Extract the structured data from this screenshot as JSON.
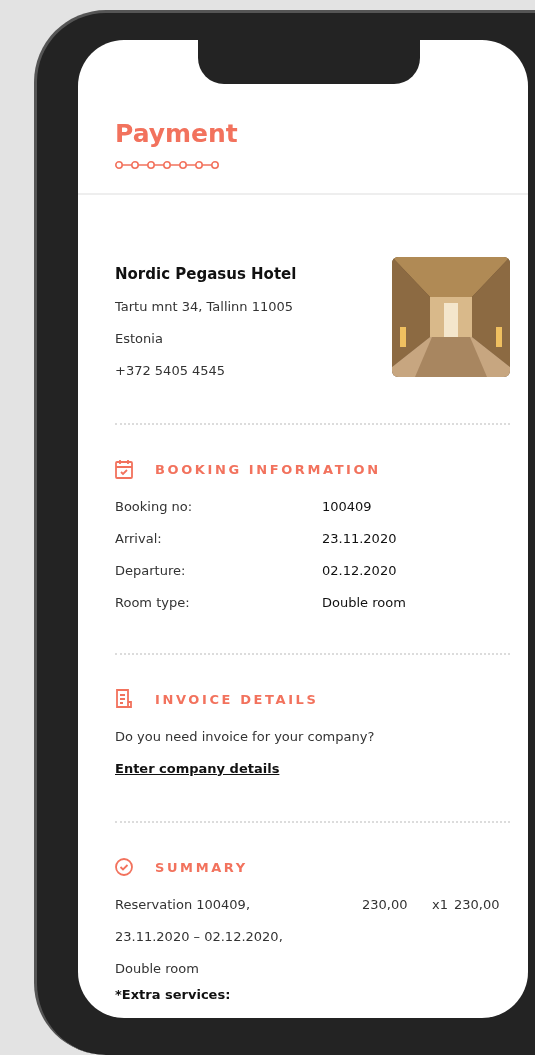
{
  "header": {
    "title": "Payment"
  },
  "hotel": {
    "name": "Nordic Pegasus Hotel",
    "address_lines": [
      "Tartu mnt 34, Tallinn 11005",
      "Estonia",
      "+372 5405 4545"
    ],
    "photo": {
      "kind": "picture"
    }
  },
  "sections": [
    {
      "kind": "details",
      "title": "BOOKING INFORMATION",
      "rows": [
        {
          "label": "Booking no:",
          "value": "100409"
        },
        {
          "label": "Arrival:",
          "value": "23.11.2020"
        },
        {
          "label": "Departure:",
          "value": "02.12.2020"
        },
        {
          "label": "Room type:",
          "value": "Double room"
        }
      ]
    },
    {
      "kind": "invoice",
      "title": "INVOICE DETAILS",
      "question": "Do you need invoice for your company?",
      "link": "Enter company details"
    },
    {
      "kind": "summary",
      "title": "SUMMARY",
      "items": [
        {
          "description_lines": [
            "Reservation 100409,",
            "23.11.2020 – 02.12.2020,",
            "Double room"
          ],
          "price": "230,00",
          "quantity": "x1",
          "total": "230,00"
        }
      ],
      "extra_label": "*Extra services:"
    }
  ]
}
